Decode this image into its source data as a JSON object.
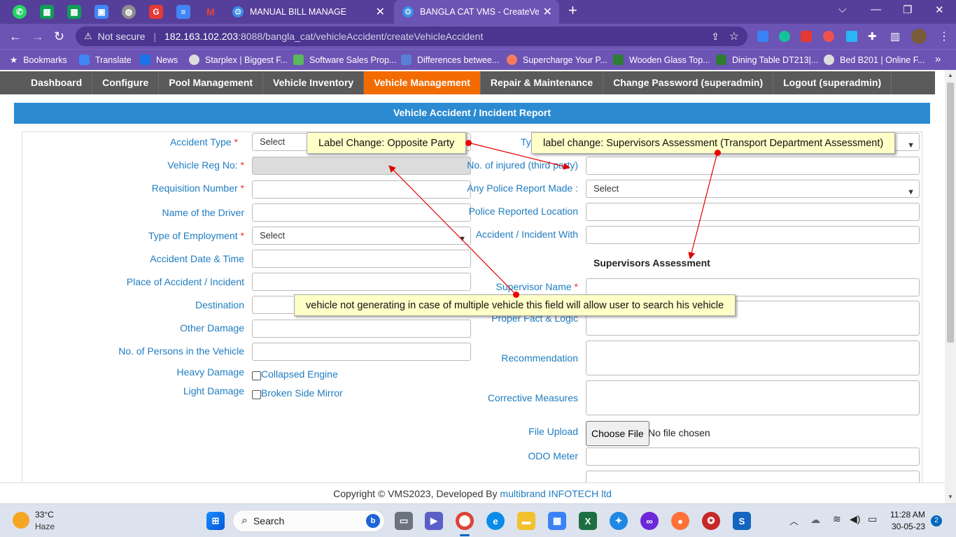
{
  "browser": {
    "tabs": [
      {
        "title": "MANUAL BILL MANAGE",
        "active": false
      },
      {
        "title": "BANGLA CAT VMS - CreateVehicl",
        "active": true
      }
    ],
    "address": {
      "security": "Not secure",
      "url_host": "182.163.102.203",
      "url_rest": ":8088/bangla_cat/vehicleAccident/createVehicleAccident"
    },
    "bookmarks": [
      "Bookmarks",
      "Translate",
      "News",
      "Starplex | Biggest F...",
      "Software Sales Prop...",
      "Differences betwee...",
      "Supercharge Your P...",
      "Wooden Glass Top...",
      "Dining Table DT213|...",
      "Bed B201 | Online F..."
    ]
  },
  "menu": {
    "items": [
      "Dashboard",
      "Configure",
      "Pool Management",
      "Vehicle Inventory",
      "Vehicle Management",
      "Repair & Maintenance",
      "Change Password (superadmin)",
      "Logout (superadmin)"
    ],
    "active": "Vehicle Management"
  },
  "form": {
    "title": "Vehicle Accident / Incident Report",
    "left": {
      "accident_type": "Accident Type",
      "vehicle_reg_no": "Vehicle Reg No:",
      "requisition_number": "Requisition Number",
      "driver_name": "Name of the Driver",
      "employment_type": "Type of Employment",
      "accident_datetime": "Accident Date & Time",
      "place": "Place of Accident / Incident",
      "destination": "Destination",
      "other_damage": "Other Damage",
      "persons": "No. of Persons in the Vehicle",
      "heavy_damage": "Heavy Damage",
      "light_damage": "Light Damage",
      "heavy_option": "Collapsed Engine",
      "light_option": "Broken Side Mirror",
      "select": "Select"
    },
    "right": {
      "type_partial": "Ty",
      "injured": "No. of injured (third party)",
      "police_report": "Any Police Report Made :",
      "police_location": "Police Reported Location",
      "accident_with": "Accident / Incident With",
      "supervisor_section": "Supervisors Assessment",
      "supervisor_name": "Supervisor Name",
      "proper_fact": "Proper Fact & Logic",
      "recommendation": "Recommendation",
      "corrective": "Corrective Measures",
      "file_upload": "File Upload",
      "choose_file": "Choose File",
      "no_file": "No file chosen",
      "odo": "ODO Meter",
      "select": "Select"
    },
    "required_mark": "*"
  },
  "footer": {
    "text": "Copyright © VMS2023, Developed By",
    "link": "multibrand INFOTECH ltd"
  },
  "annotations": {
    "opposite_party": "Label Change: Opposite Party",
    "supervisor_label": "label change: Supervisors Assessment (Transport Department Assessment)",
    "vehicle_search": "vehicle not generating in case of multiple vehicle this field will allow user to search his vehicle",
    "color": "#e00000"
  },
  "taskbar": {
    "weather_temp": "33°C",
    "weather_desc": "Haze",
    "search": "Search",
    "time": "11:28 AM",
    "date": "30-05-23",
    "notifications": "2"
  },
  "colors": {
    "browser_purple": "#553f9a",
    "menu_active": "#f36b00",
    "form_header": "#2c8ad1",
    "label_blue": "#1f7cc0"
  }
}
